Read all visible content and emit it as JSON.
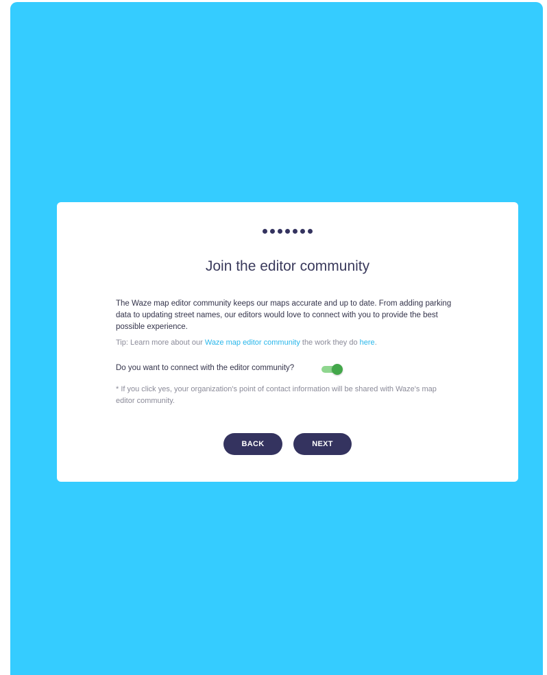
{
  "step_indicator": {
    "count": 7,
    "color": "#34335f"
  },
  "card": {
    "title": "Join the editor community",
    "description": "The Waze map editor community keeps our maps accurate and up to date. From adding parking data to updating street names, our editors would love to connect with you to provide the best possible experience.",
    "tip": {
      "prefix": "Tip: Learn more about our ",
      "link1": "Waze map editor community",
      "middle": " the work they do ",
      "link2": "here",
      "suffix": "."
    },
    "question": "Do you want to connect with the editor community?",
    "toggle": {
      "on": true
    },
    "note": "* If you click yes, your organization's point of contact information will be shared with Waze's map editor community.",
    "buttons": {
      "back": "BACK",
      "next": "NEXT"
    }
  },
  "colors": {
    "background": "#35ccff",
    "primary": "#34335f",
    "link": "#28b6ea",
    "toggle_on": "#43a74a"
  }
}
